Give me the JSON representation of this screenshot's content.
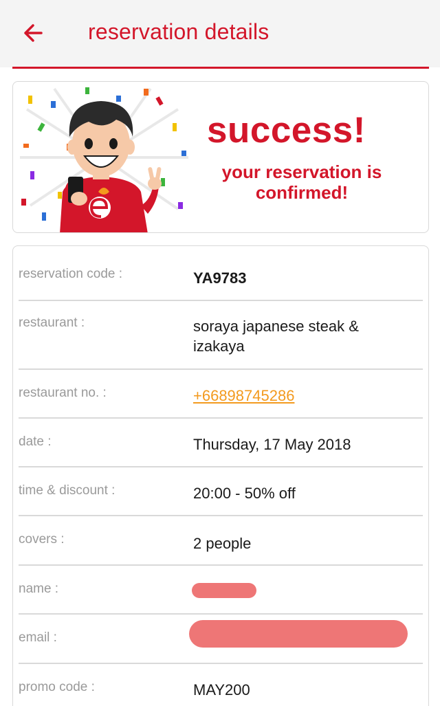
{
  "header": {
    "title": "reservation details",
    "back_icon": "arrow-left-icon",
    "accent_color": "#d3162a"
  },
  "banner": {
    "headline": "success!",
    "message": "your reservation is confirmed!",
    "mascot": "mascot-illustration-icon"
  },
  "details": {
    "rows": [
      {
        "label": "reservation code :",
        "value": "YA9783"
      },
      {
        "label": "restaurant :",
        "value": "soraya japanese steak & izakaya"
      },
      {
        "label": "restaurant no. :",
        "value": "+66898745286"
      },
      {
        "label": "date :",
        "value": "Thursday, 17 May 2018"
      },
      {
        "label": "time & discount :",
        "value": "20:00 - 50% off"
      },
      {
        "label": "covers :",
        "value": "2 people"
      },
      {
        "label": "name :",
        "value": ""
      },
      {
        "label": "email :",
        "value": ""
      },
      {
        "label": "promo code :",
        "value": "MAY200"
      }
    ],
    "link_color": "#f39a1e",
    "redaction_color": "#ee7676"
  }
}
